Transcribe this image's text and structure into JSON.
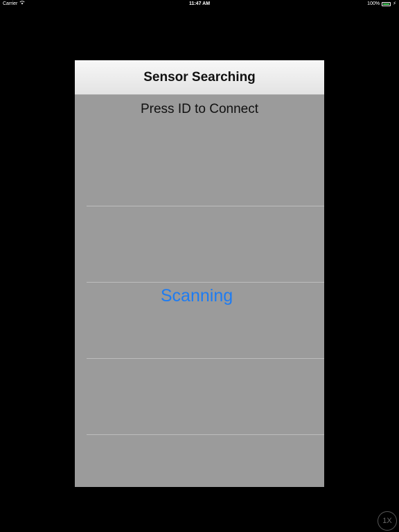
{
  "status_bar": {
    "carrier": "Carrier",
    "time": "11:47 AM",
    "battery_percent": "100%",
    "wifi_icon": "wifi-icon",
    "battery_icon": "battery-icon",
    "charging_icon": "charging-bolt-icon"
  },
  "header": {
    "title": "Sensor Searching"
  },
  "main": {
    "instruction": "Press ID to Connect",
    "scanning_label": "Scanning"
  },
  "badge": {
    "label": "1X"
  },
  "colors": {
    "background": "#000000",
    "panel": "#9b9b9b",
    "accent": "#1e7cf2"
  }
}
